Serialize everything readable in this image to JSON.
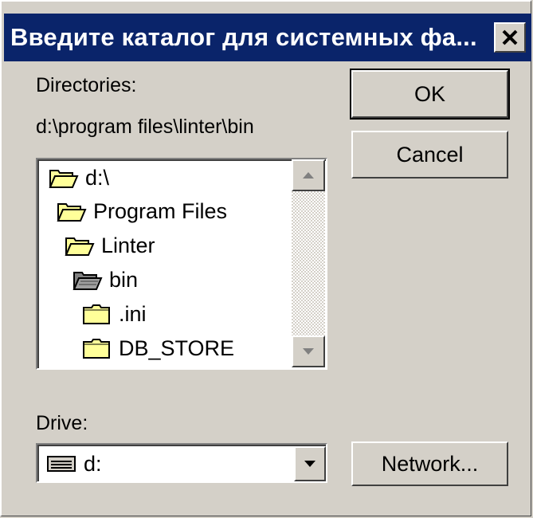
{
  "window": {
    "title": "Введите каталог для системных фа..."
  },
  "labels": {
    "directories": "Directories:",
    "current_path": "d:\\program files\\linter\\bin",
    "drive": "Drive:"
  },
  "buttons": {
    "ok": "OK",
    "cancel": "Cancel",
    "network": "Network..."
  },
  "directories": [
    {
      "name": "d:\\",
      "icon": "open-folder-icon"
    },
    {
      "name": "Program Files",
      "icon": "open-folder-icon"
    },
    {
      "name": "Linter",
      "icon": "open-folder-icon"
    },
    {
      "name": "bin",
      "icon": "open-folder-selected-icon"
    },
    {
      "name": ".ini",
      "icon": "closed-folder-icon"
    },
    {
      "name": "DB_STORE",
      "icon": "closed-folder-icon"
    }
  ],
  "drive": {
    "value": "d:",
    "icon": "drive-icon"
  },
  "colors": {
    "titlebar": "#0a246a",
    "face": "#d4d0c8",
    "folder": "#ffff99"
  }
}
